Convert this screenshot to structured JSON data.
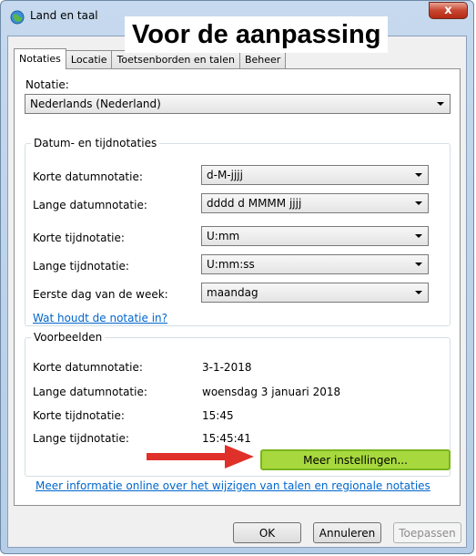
{
  "window": {
    "title": "Land en taal",
    "close_label": "x",
    "overlay": "Voor de aanpassing"
  },
  "tabs": [
    {
      "label": "Notaties"
    },
    {
      "label": "Locatie"
    },
    {
      "label": "Toetsenborden en talen"
    },
    {
      "label": "Beheer"
    }
  ],
  "notatie": {
    "label": "Notatie:",
    "value": "Nederlands (Nederland)"
  },
  "formats": {
    "title": "Datum- en tijdnotaties",
    "rows": [
      {
        "label": "Korte datumnotatie:",
        "value": "d-M-jjjj"
      },
      {
        "label": "Lange datumnotatie:",
        "value": "dddd d MMMM jjjj"
      },
      {
        "label": "Korte tijdnotatie:",
        "value": "U:mm"
      },
      {
        "label": "Lange tijdnotatie:",
        "value": "U:mm:ss"
      },
      {
        "label": "Eerste dag van de week:",
        "value": "maandag"
      }
    ],
    "link": "Wat houdt de notatie in?"
  },
  "examples": {
    "title": "Voorbeelden",
    "rows": [
      {
        "label": "Korte datumnotatie:",
        "value": "3-1-2018"
      },
      {
        "label": "Lange datumnotatie:",
        "value": "woensdag 3 januari 2018"
      },
      {
        "label": "Korte tijdnotatie:",
        "value": "15:45"
      },
      {
        "label": "Lange tijdnotatie:",
        "value": "15:45:41"
      }
    ]
  },
  "more_settings_label": "Meer instellingen...",
  "info_link": "Meer informatie online over het wijzigen van talen en regionale notaties",
  "footer": {
    "ok": "OK",
    "cancel": "Annuleren",
    "apply": "Toepassen"
  },
  "colors": {
    "highlight_button": "#a7d93e",
    "arrow": "#e0302a",
    "link": "#0066cc"
  }
}
